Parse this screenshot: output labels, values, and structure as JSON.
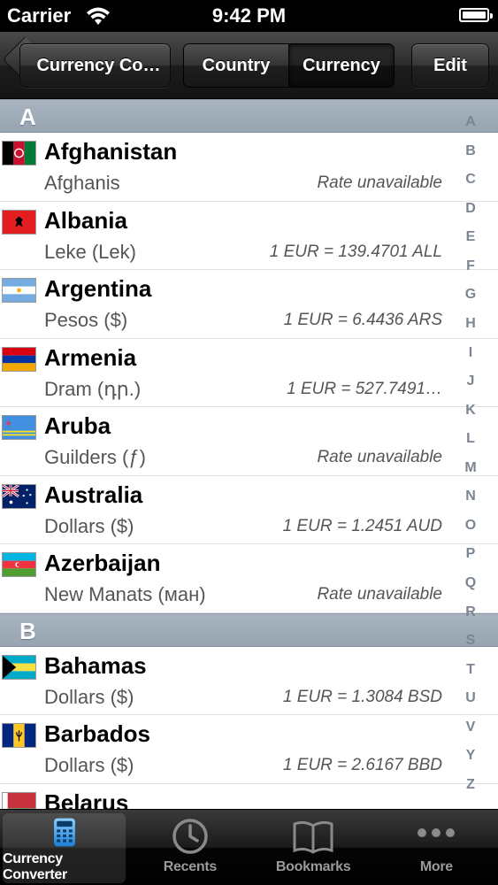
{
  "status_bar": {
    "carrier": "Carrier",
    "time": "9:42 PM"
  },
  "nav": {
    "back_label": "Currency Co…",
    "segments": [
      "Country",
      "Currency"
    ],
    "selected_segment": "Currency",
    "edit_label": "Edit"
  },
  "sections": [
    {
      "letter": "A",
      "rows": [
        {
          "country": "Afghanistan",
          "currency": "Afghanis",
          "rate": "Rate unavailable"
        },
        {
          "country": "Albania",
          "currency": "Leke (Lek)",
          "rate": "1 EUR = 139.4701 ALL"
        },
        {
          "country": "Argentina",
          "currency": "Pesos ($)",
          "rate": "1 EUR = 6.4436 ARS"
        },
        {
          "country": "Armenia",
          "currency": "Dram (դր.)",
          "rate": "1 EUR = 527.7491…"
        },
        {
          "country": "Aruba",
          "currency": "Guilders (ƒ)",
          "rate": "Rate unavailable"
        },
        {
          "country": "Australia",
          "currency": "Dollars ($)",
          "rate": "1 EUR = 1.2451 AUD"
        },
        {
          "country": "Azerbaijan",
          "currency": "New Manats (ман)",
          "rate": "Rate unavailable"
        }
      ]
    },
    {
      "letter": "B",
      "rows": [
        {
          "country": "Bahamas",
          "currency": "Dollars ($)",
          "rate": "1 EUR = 1.3084 BSD"
        },
        {
          "country": "Barbados",
          "currency": "Dollars ($)",
          "rate": "1 EUR = 2.6167 BBD"
        },
        {
          "country": "Belarus",
          "currency": "",
          "rate": ""
        }
      ]
    }
  ],
  "index_letters": [
    "A",
    "B",
    "C",
    "D",
    "E",
    "F",
    "G",
    "H",
    "I",
    "J",
    "K",
    "L",
    "M",
    "N",
    "O",
    "P",
    "Q",
    "R",
    "S",
    "T",
    "U",
    "V",
    "Y",
    "Z"
  ],
  "tabs": [
    {
      "label": "Currency Converter",
      "icon": "calculator-icon",
      "active": true
    },
    {
      "label": "Recents",
      "icon": "clock-icon",
      "active": false
    },
    {
      "label": "Bookmarks",
      "icon": "book-icon",
      "active": false
    },
    {
      "label": "More",
      "icon": "more-dots-icon",
      "active": false
    }
  ],
  "colors": {
    "section_header": "#a0adba",
    "index_text": "#7b8591",
    "nav_bar": "#2c2c2c"
  }
}
